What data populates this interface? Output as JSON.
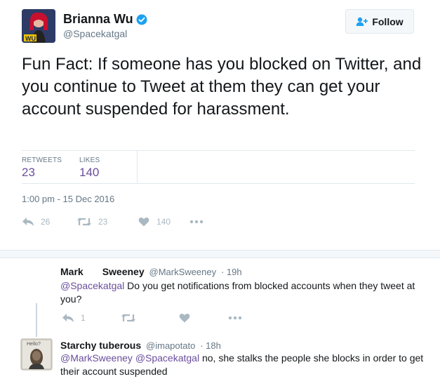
{
  "main_tweet": {
    "author_name": "Brianna Wu",
    "author_handle": "@Spacekatgal",
    "follow_label": "Follow",
    "text": "Fun Fact: If someone has you blocked on Twitter, and you continue to Tweet at them they can get your account suspended for harassment.",
    "stats": {
      "retweets_label": "RETWEETS",
      "retweets_value": "23",
      "likes_label": "LIKES",
      "likes_value": "140"
    },
    "timestamp": "1:00 pm - 15 Dec 2016",
    "actions": {
      "reply_count": "26",
      "retweet_count": "23",
      "like_count": "140"
    },
    "avatar_badge": "WU"
  },
  "replies": [
    {
      "first_name": "Mark",
      "last_name": "Sweeney",
      "handle": "@MarkSweeney",
      "time": "· 19h",
      "mention": "@Spacekatgal",
      "text": " Do you get notifications from blocked accounts when they tweet at you?",
      "reply_count": "1"
    },
    {
      "name": "Starchy tuberous",
      "handle": "@imapotato",
      "time": "· 18h",
      "mention1": "@MarkSweeney",
      "mention2": "@Spacekatgal",
      "text": " no, she stalks the people she blocks in order to get their account suspended",
      "avatar_caption": "Hello?"
    }
  ],
  "colors": {
    "accent": "#6a4e9c",
    "muted": "#657786",
    "icon": "#aab8c2",
    "verified": "#1da1f2"
  }
}
